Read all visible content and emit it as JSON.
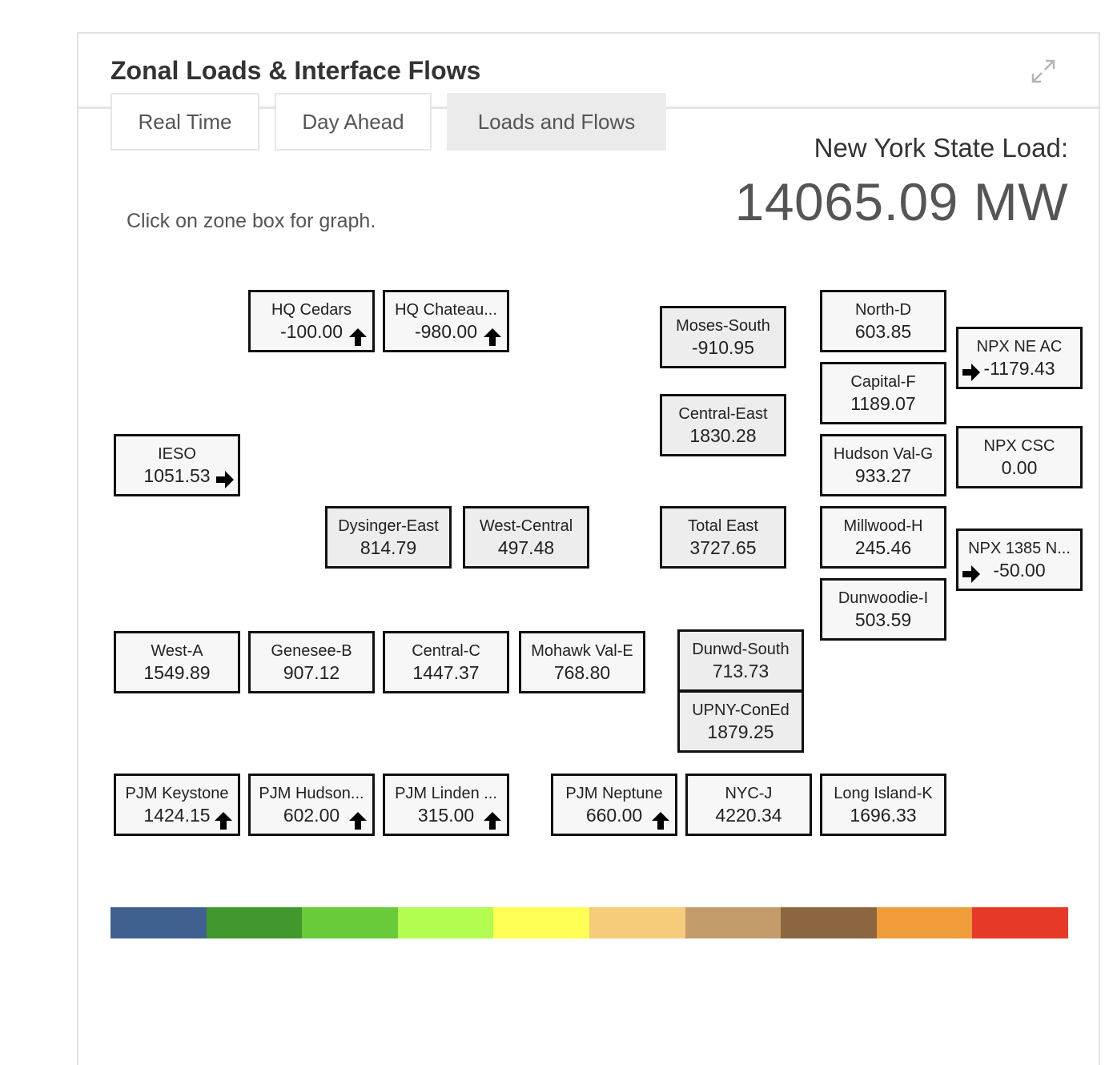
{
  "panel": {
    "title": "Zonal Loads & Interface Flows",
    "expand_icon": "expand-arrows-icon"
  },
  "tabs": [
    {
      "label": "Real Time",
      "active": false
    },
    {
      "label": "Day Ahead",
      "active": false
    },
    {
      "label": "Loads and Flows",
      "active": true
    }
  ],
  "hint": "Click on zone box for graph.",
  "state_load": {
    "label": "New York State Load:",
    "value": "14065.09 MW"
  },
  "map_fill_color": "#7388b0",
  "zones": [
    {
      "name": "HQ Cedars",
      "value": "-100.00",
      "arrow": "up"
    },
    {
      "name": "HQ Chateau...",
      "value": "-980.00",
      "arrow": "up"
    },
    {
      "name": "Moses-South",
      "value": "-910.95"
    },
    {
      "name": "North-D",
      "value": "603.85"
    },
    {
      "name": "NPX NE AC",
      "value": "-1179.43",
      "arrow": "right"
    },
    {
      "name": "Capital-F",
      "value": "1189.07"
    },
    {
      "name": "Central-East",
      "value": "1830.28"
    },
    {
      "name": "IESO",
      "value": "1051.53",
      "arrow": "right"
    },
    {
      "name": "Hudson Val-G",
      "value": "933.27"
    },
    {
      "name": "NPX CSC",
      "value": "0.00"
    },
    {
      "name": "Dysinger-East",
      "value": "814.79"
    },
    {
      "name": "West-Central",
      "value": "497.48"
    },
    {
      "name": "Total East",
      "value": "3727.65"
    },
    {
      "name": "Millwood-H",
      "value": "245.46"
    },
    {
      "name": "NPX 1385 N...",
      "value": "-50.00",
      "arrow": "right"
    },
    {
      "name": "Dunwoodie-I",
      "value": "503.59"
    },
    {
      "name": "West-A",
      "value": "1549.89"
    },
    {
      "name": "Genesee-B",
      "value": "907.12"
    },
    {
      "name": "Central-C",
      "value": "1447.37"
    },
    {
      "name": "Mohawk Val-E",
      "value": "768.80"
    },
    {
      "name": "Dunwd-South",
      "value": "713.73"
    },
    {
      "name": "UPNY-ConEd",
      "value": "1879.25"
    },
    {
      "name": "PJM Keystone",
      "value": "1424.15",
      "arrow": "up"
    },
    {
      "name": "PJM Hudson...",
      "value": "602.00",
      "arrow": "up"
    },
    {
      "name": "PJM Linden ...",
      "value": "315.00",
      "arrow": "up"
    },
    {
      "name": "PJM Neptune",
      "value": "660.00",
      "arrow": "up"
    },
    {
      "name": "NYC-J",
      "value": "4220.34"
    },
    {
      "name": "Long Island-K",
      "value": "1696.33"
    }
  ],
  "legend_colors": [
    "#40618f",
    "#41982c",
    "#6acb3a",
    "#b1fc4e",
    "#fefe55",
    "#f4cc7a",
    "#c49c6c",
    "#8c6640",
    "#ef9d3b",
    "#e73927"
  ]
}
